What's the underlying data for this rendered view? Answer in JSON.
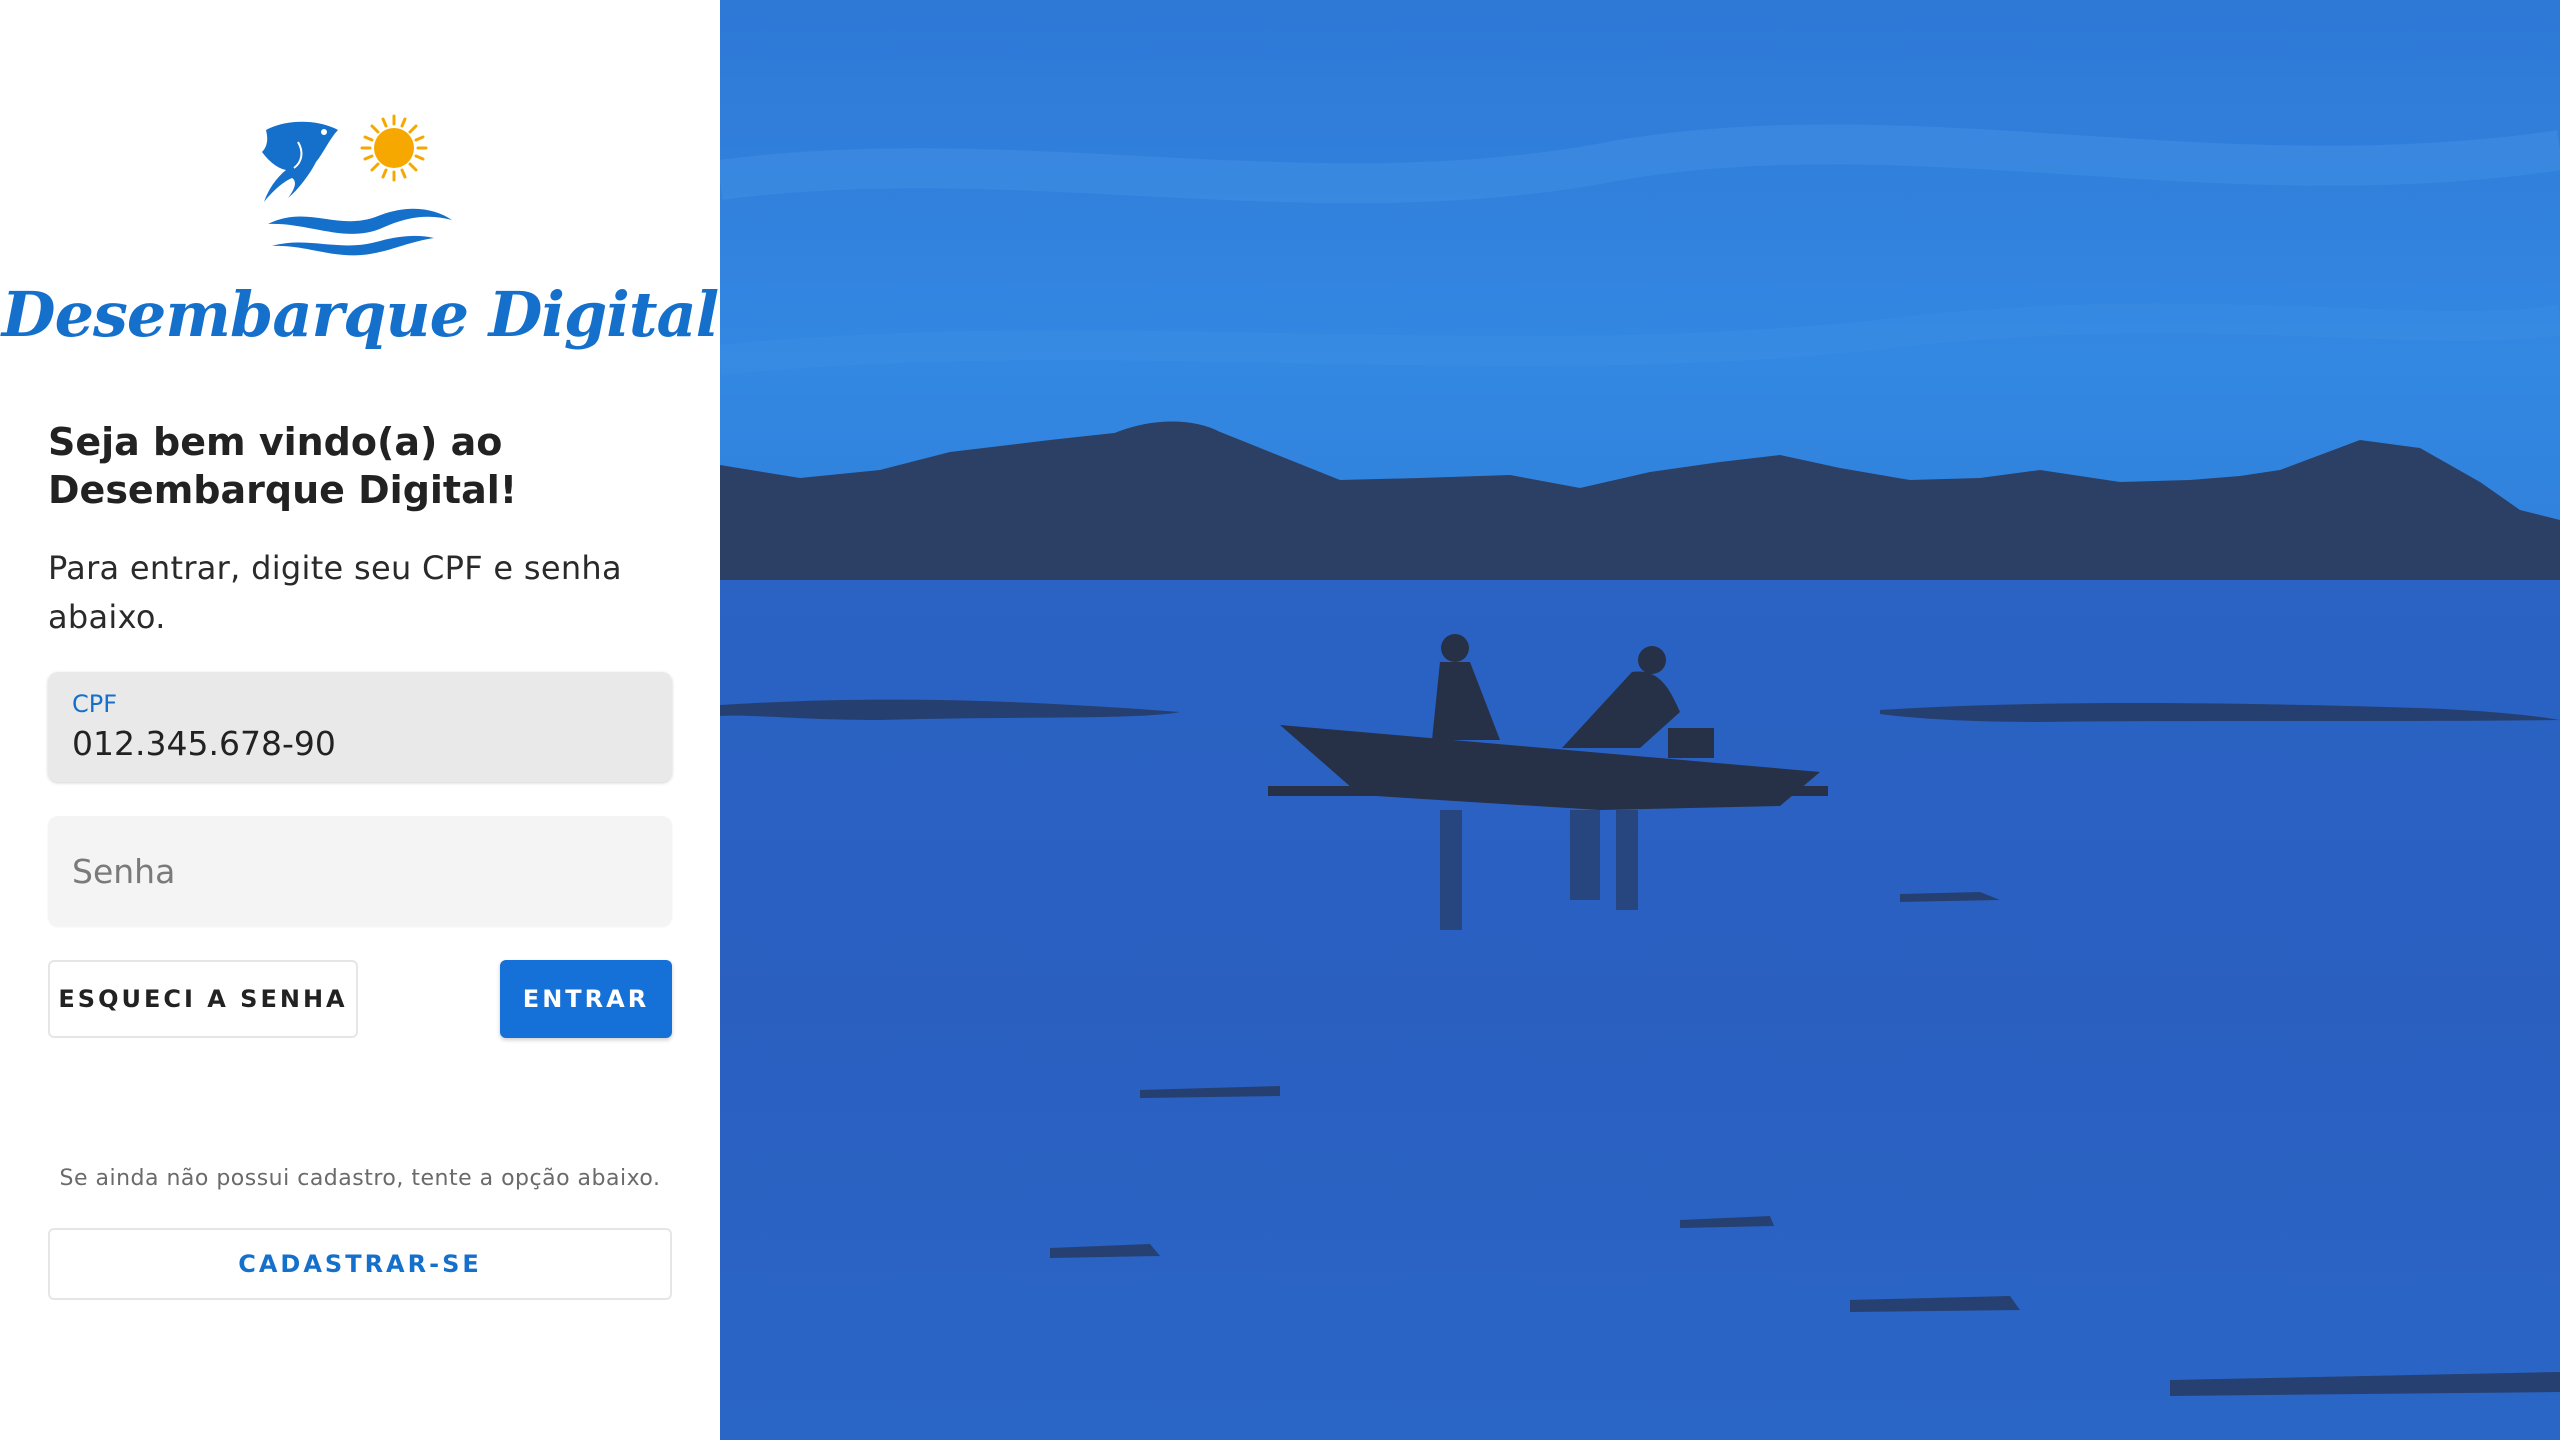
{
  "app": {
    "title": "Desembarque Digital"
  },
  "login": {
    "heading": "Seja bem vindo(a) ao Desembarque Digital!",
    "instructions": "Para entrar, digite seu CPF e senha abaixo.",
    "cpf": {
      "label": "CPF",
      "value": "012.345.678-90"
    },
    "password": {
      "placeholder": "Senha",
      "value": ""
    },
    "forgot_label": "ESQUECI A SENHA",
    "enter_label": "ENTRAR",
    "signup_note": "Se ainda não possui cadastro, tente a opção abaixo.",
    "signup_label": "CADASTRAR-SE"
  },
  "icons": {
    "logo": "fish-sun-waves-logo"
  },
  "colors": {
    "brand_blue": "#1570cc",
    "button_blue": "#1570d8",
    "sun_orange": "#f6a800",
    "photo_water": "#2a62c2",
    "photo_sky": "#2f7fdc"
  }
}
